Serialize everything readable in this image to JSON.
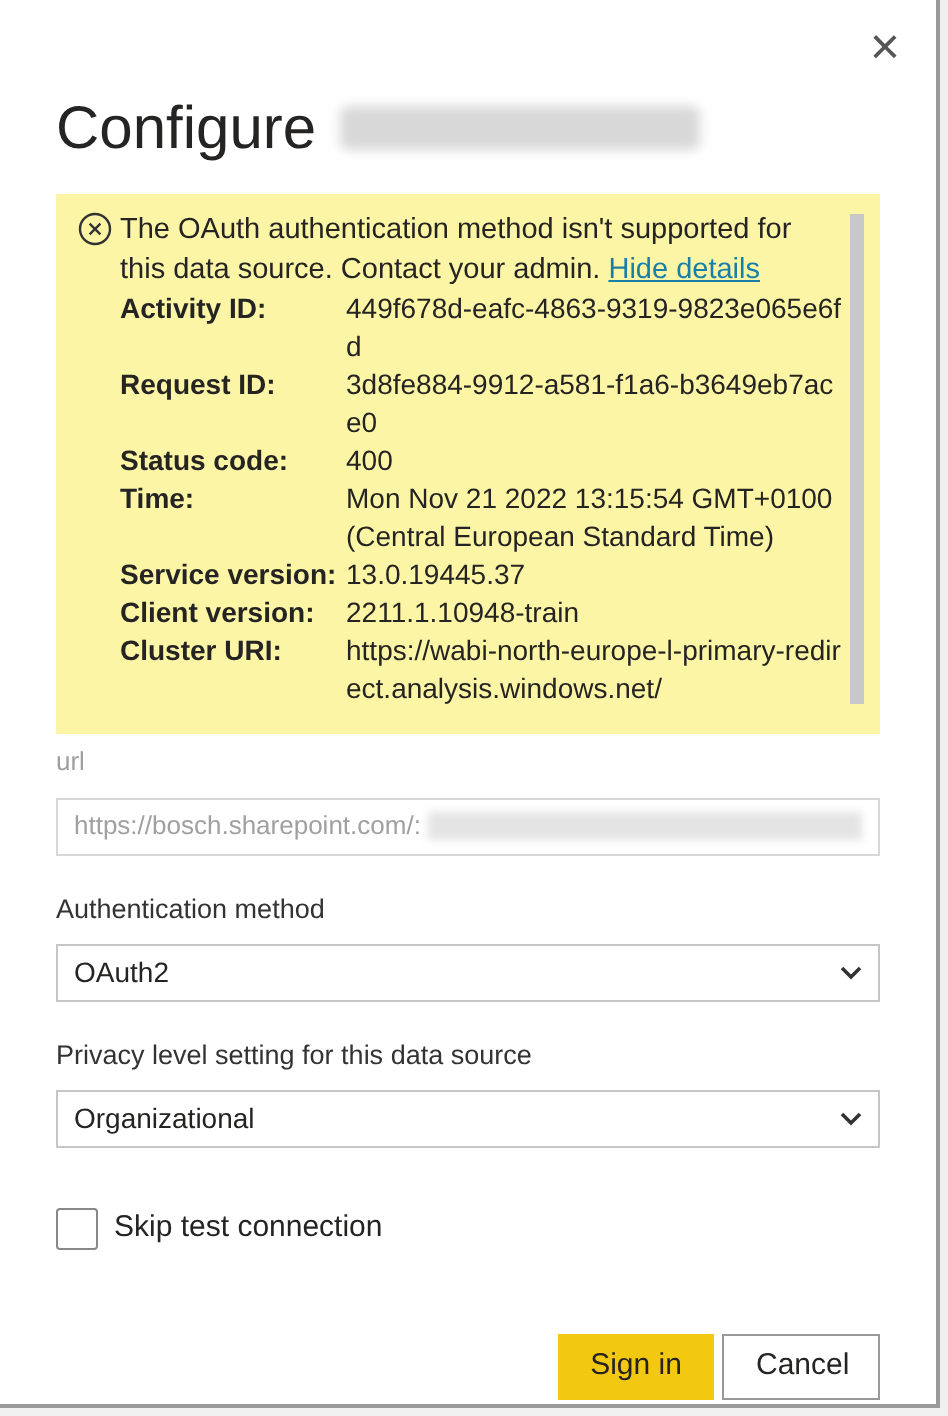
{
  "dialog": {
    "title": "Configure",
    "close": "×"
  },
  "error": {
    "message": "The OAuth authentication method isn't supported for this data source. Contact your admin.",
    "link": "Hide details",
    "details": [
      {
        "label": "Activity ID:",
        "value": "449f678d-eafc-4863-9319-9823e065e6fd"
      },
      {
        "label": "Request ID:",
        "value": "3d8fe884-9912-a581-f1a6-b3649eb7ace0"
      },
      {
        "label": "Status code:",
        "value": "400"
      },
      {
        "label": "Time:",
        "value": "Mon Nov 21 2022 13:15:54 GMT+0100 (Central European Standard Time)"
      },
      {
        "label": "Service version:",
        "value": "13.0.19445.37"
      },
      {
        "label": "Client version:",
        "value": "2211.1.10948-train"
      },
      {
        "label": "Cluster URI:",
        "value": "https://wabi-north-europe-l-primary-redirect.analysis.windows.net/"
      }
    ]
  },
  "url": {
    "label": "url",
    "value": "https://bosch.sharepoint.com/:"
  },
  "fields": [
    {
      "label": "Authentication method",
      "value": "OAuth2"
    },
    {
      "label": "Privacy level setting for this data source",
      "value": "Organizational"
    }
  ],
  "skip_test": {
    "label": "Skip test connection",
    "checked": false
  },
  "buttons": [
    {
      "label": "Sign in",
      "kind": "primary"
    },
    {
      "label": "Cancel",
      "kind": "secondary"
    }
  ]
}
